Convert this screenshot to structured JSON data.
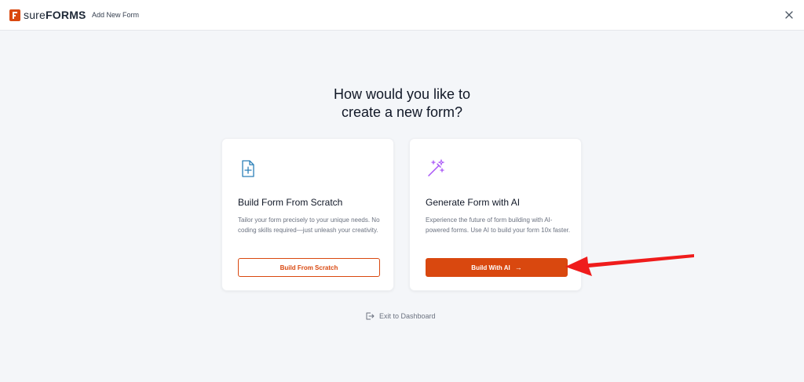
{
  "header": {
    "logo_strong": "sure",
    "logo_caps": "FORMS",
    "breadcrumb_sep": "›",
    "breadcrumb": "Add New Form"
  },
  "heading": {
    "line1": "How would you like to",
    "line2": "create a new form?"
  },
  "cards": [
    {
      "icon": "file-plus-icon",
      "title": "Build Form From Scratch",
      "description": "Tailor your form precisely to your unique needs. No coding skills required—just unleash your creativity.",
      "button": "Build From Scratch"
    },
    {
      "icon": "magic-wand-icon",
      "title": "Generate Form with AI",
      "description": "Experience the future of form building with AI-powered forms. Use AI to build your form 10x faster.",
      "button": "Build With AI",
      "button_arrow": "→"
    }
  ],
  "exit": {
    "icon": "logout-icon",
    "label": "Exit to Dashboard"
  },
  "colors": {
    "brand": "#d9480f",
    "annotation_arrow": "#ef1c1c",
    "background": "#f4f6f9"
  }
}
